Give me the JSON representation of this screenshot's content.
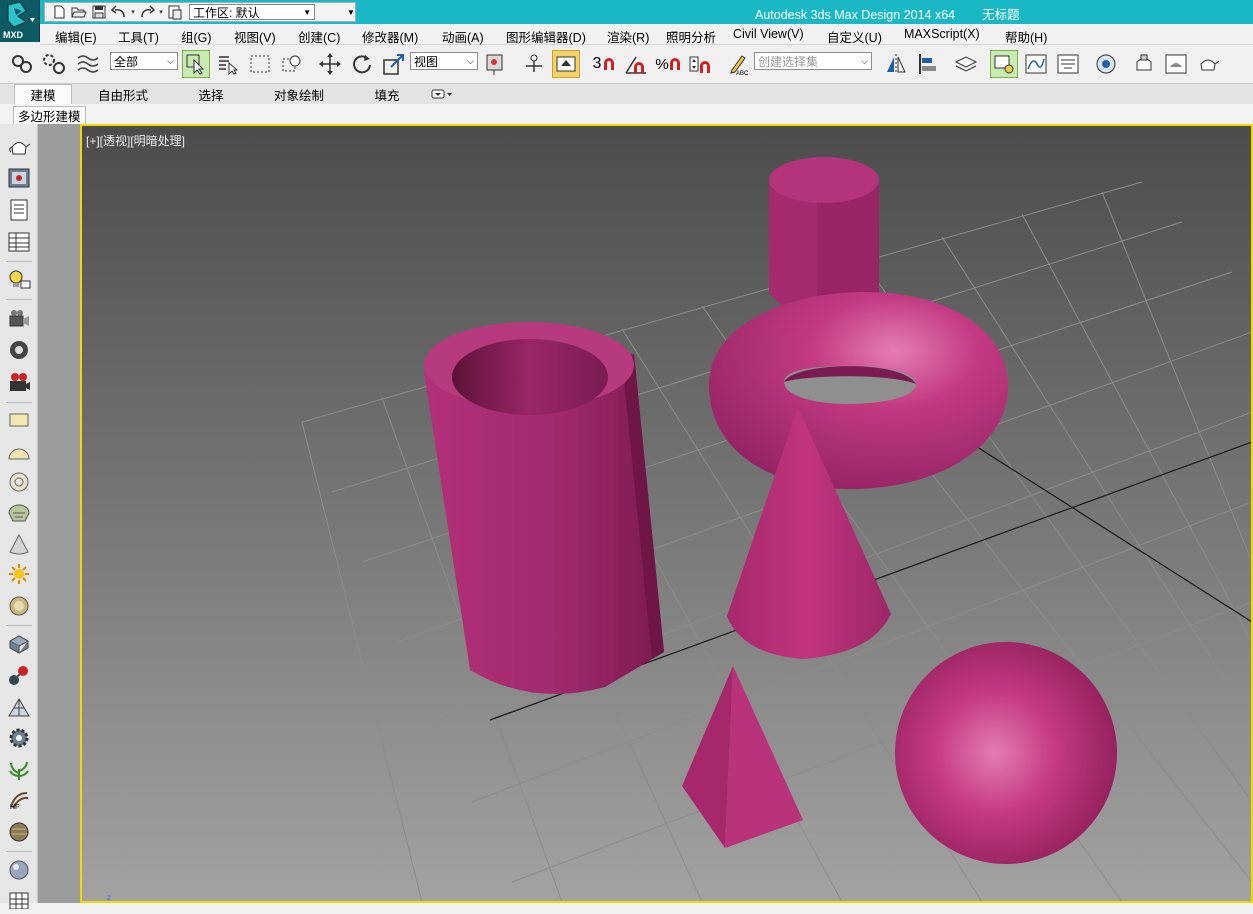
{
  "colors": {
    "titlebar": "#1ab7c4",
    "viewport_border": "#f2d900",
    "object": "#b42e74",
    "viewport_bg_top": "#4c4c4c",
    "viewport_bg_bottom": "#a2a2a2"
  },
  "app": {
    "badge": "MXD",
    "title": "Autodesk 3ds Max Design 2014 x64",
    "document": "无标题"
  },
  "quick_access": {
    "workspace_label": "工作区: 默认",
    "items": [
      "new-icon",
      "open-icon",
      "save-icon",
      "undo-icon",
      "redo-icon",
      "project-folder-icon"
    ]
  },
  "menu": {
    "items": [
      "编辑(E)",
      "工具(T)",
      "组(G)",
      "视图(V)",
      "创建(C)",
      "修改器(M)",
      "动画(A)",
      "图形编辑器(D)",
      "渲染(R)",
      "照明分析",
      "Civil View(V)",
      "自定义(U)",
      "MAXScript(X)",
      "帮助(H)"
    ]
  },
  "toolbar": {
    "selection_filter": "全部",
    "reference_coord": "视图",
    "named_selection_placeholder": "创建选择集",
    "snap_label": "3"
  },
  "ribbon": {
    "tabs": [
      "建模",
      "自由形式",
      "选择",
      "对象绘制",
      "填充"
    ],
    "active_tab": "建模",
    "panel_label": "多边形建模"
  },
  "viewport": {
    "label": "[+][透视][明暗处理]",
    "gizmo_label": "z"
  }
}
